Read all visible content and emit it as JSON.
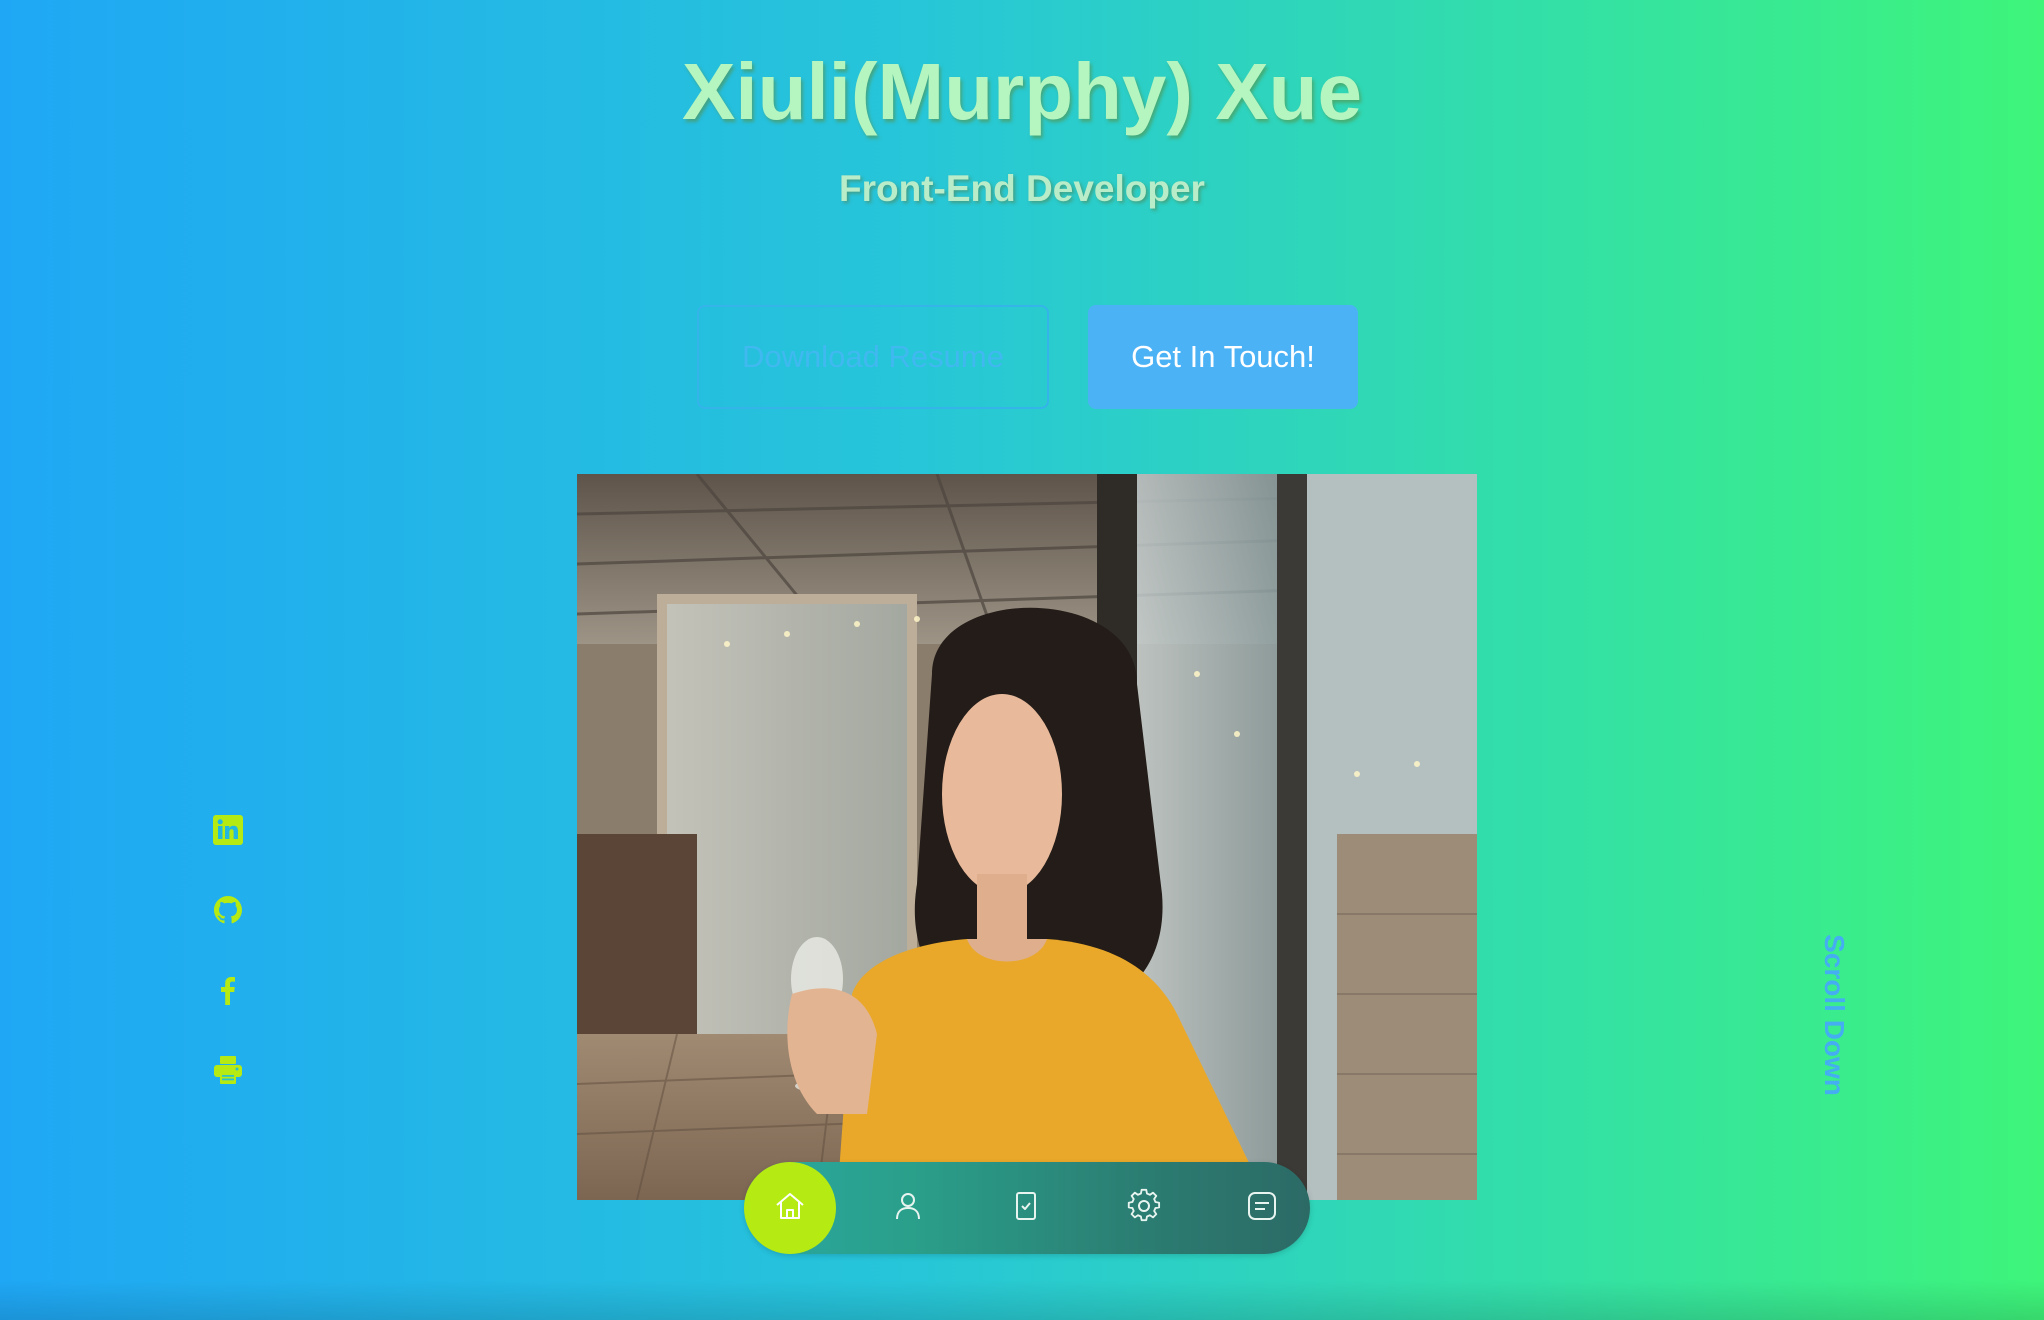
{
  "header": {
    "name": "Xiuli(Murphy) Xue",
    "role": "Front-End Developer"
  },
  "actions": {
    "download_label": "Download Resume",
    "contact_label": "Get In Touch!"
  },
  "social": [
    {
      "icon": "linkedin-icon"
    },
    {
      "icon": "github-icon"
    },
    {
      "icon": "facebook-icon"
    },
    {
      "icon": "printer-icon"
    }
  ],
  "scroll_label": "Scroll Down",
  "nav": {
    "items": [
      {
        "icon": "home-icon",
        "active": true
      },
      {
        "icon": "user-icon",
        "active": false
      },
      {
        "icon": "clipboard-check-icon",
        "active": false
      },
      {
        "icon": "gear-icon",
        "active": false
      },
      {
        "icon": "message-icon",
        "active": false
      }
    ]
  },
  "colors": {
    "accent": "#b6ea13",
    "button": "#4cb2f6",
    "title": "#b5f5c0",
    "scroll": "#45aef3"
  }
}
